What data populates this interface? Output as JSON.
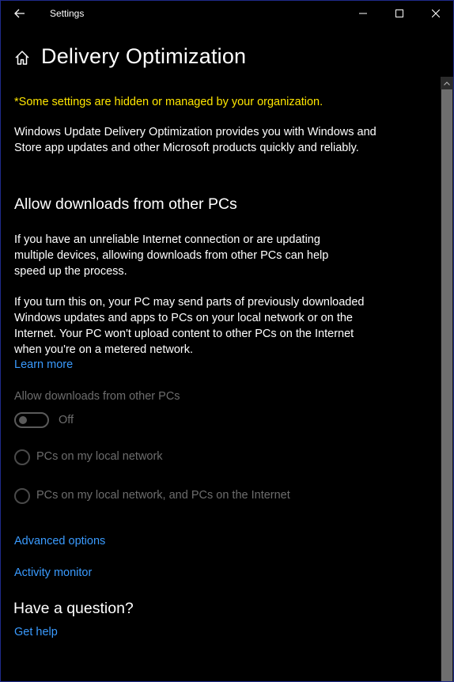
{
  "titlebar": {
    "app_title": "Settings",
    "back_icon": "back-arrow-icon",
    "minimize_icon": "minimize-icon",
    "maximize_icon": "maximize-icon",
    "close_icon": "close-icon"
  },
  "header": {
    "home_icon": "home-icon",
    "title": "Delivery Optimization"
  },
  "content": {
    "org_note": "*Some settings are hidden or managed by your organization.",
    "intro": "Windows Update Delivery Optimization provides you with Windows and Store app updates and other Microsoft products quickly and reliably.",
    "section_title": "Allow downloads from other PCs",
    "para1": "If you have an unreliable Internet connection or are updating multiple devices, allowing downloads from other PCs can help speed up the process.",
    "para2": "If you turn this on, your PC may send parts of previously downloaded Windows updates and apps to PCs on your local network or on the Internet. Your PC won't upload content to other PCs on the Internet when you're on a metered network.",
    "learn_more": "Learn more",
    "setting_label": "Allow downloads from other PCs",
    "toggle_state": "Off",
    "toggle_on": false,
    "radio_options": [
      "PCs on my local network",
      "PCs on my local network, and PCs on the Internet"
    ],
    "advanced_options": "Advanced options",
    "activity_monitor": "Activity monitor"
  },
  "help": {
    "title": "Have a question?",
    "get_help": "Get help"
  },
  "colors": {
    "background": "#000000",
    "text": "#ffffff",
    "warning": "#ffe600",
    "link": "#3a9bff",
    "disabled": "#6d6d6d",
    "window_border": "#1f2a8a"
  }
}
